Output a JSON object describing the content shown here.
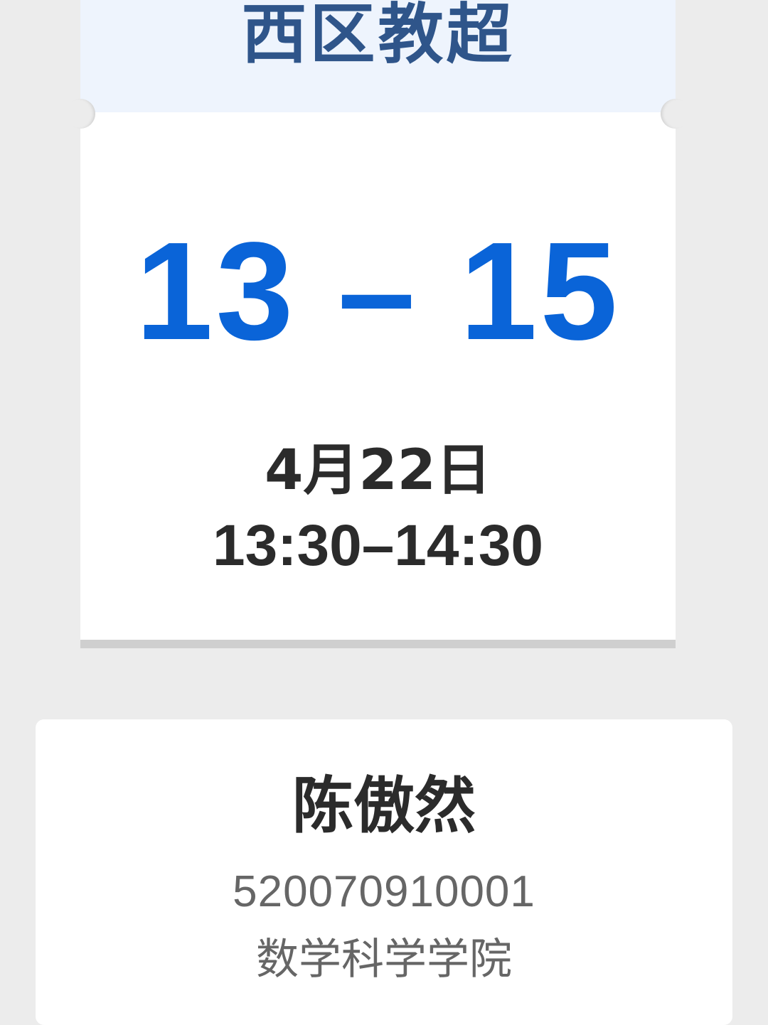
{
  "ticket": {
    "location": "西区教超",
    "period": "13 – 15",
    "date": "4月22日",
    "time": "13:30–14:30"
  },
  "student": {
    "name": "陈傲然",
    "id": "520070910001",
    "department": "数学科学学院"
  },
  "colors": {
    "accent": "#0a64d8",
    "header_text": "#2f558a",
    "header_bg": "#eef4fd",
    "page_bg": "#ececec"
  }
}
